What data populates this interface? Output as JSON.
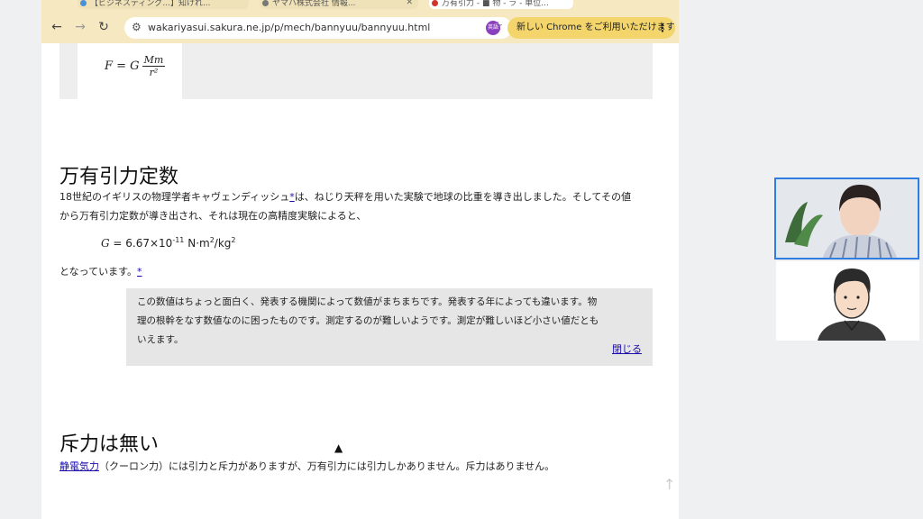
{
  "browser": {
    "tabs": [
      {
        "title": "【ビジネスディング...】知けれ..."
      },
      {
        "title": "ヤマハ株式会社 情報..."
      },
      {
        "title": "万有引力 - ■ 物 - ラ - 単位..."
      }
    ],
    "url": "wakariyasui.sakura.ne.jp/p/mech/bannyuu/bannyuu.html",
    "profile_label": "英語",
    "update_label": "新しい Chrome をご利用いただけます",
    "nav": {
      "back": "←",
      "forward": "→",
      "reload": "↻",
      "more": "⋮",
      "star": "☆",
      "tune": "⚙"
    }
  },
  "page": {
    "formula": {
      "lhs": "F = G",
      "num": "Mm",
      "den": "r²"
    },
    "section1": {
      "heading": "万有引力定数",
      "para1": "18世紀のイギリスの物理学者キャヴェンディッシュ",
      "para1_link": "*",
      "para1_rest": "は、ねじり天秤を用いた実験で地球の比重を導き出しました。そしてその値",
      "para2": "から万有引力定数が導き出され、それは現在の高精度実験によると、",
      "g_var": "G",
      "g_eq": " = 6.67×10",
      "g_exp": "-11",
      "g_unit": " N·m",
      "g_unit_exp1": "2",
      "g_unit_mid": "/kg",
      "g_unit_exp2": "2",
      "para3": "となっています。",
      "para3_link": "*",
      "note_line1": "この数値はちょっと面白く、発表する機関によって数値がまちまちです。発表する年によっても違います。物",
      "note_line2": "理の根幹をなす数値なのに困ったものです。測定するのが難しいようです。測定が難しいほど小さい値だとも",
      "note_line3": "いえます。",
      "note_close": "閉じる"
    },
    "section2": {
      "heading": "斥力は無い",
      "link": "静電気力",
      "text": "（クーロン力）には引力と斥力がありますが、万有引力には引力しかありません。斥力はありません。"
    },
    "scroll_arrow": "↑"
  },
  "colors": {
    "toolbar": "#f6e9c2",
    "update_pill": "#f3d56c",
    "link": "#1a0dab",
    "note_bg": "#e6e6e6",
    "webcam_border": "#2f7de1"
  }
}
